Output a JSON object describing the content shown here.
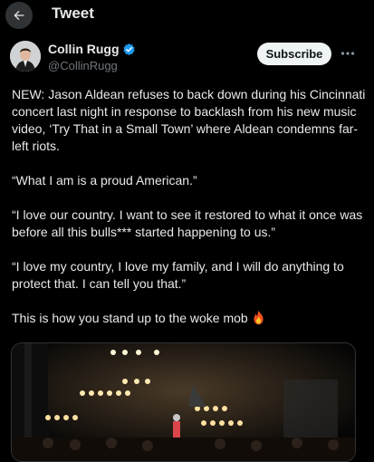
{
  "header": {
    "title": "Tweet"
  },
  "author": {
    "name": "Collin Rugg",
    "handle": "@CollinRugg"
  },
  "subscribe_label": "Subscribe",
  "tweet": {
    "paragraphs": [
      "NEW: Jason Aldean refuses to back down during his Cincinnati concert last night in response to backlash from his new music video, ‘Try That in a Small Town’ where Aldean condemns far-left riots.",
      "“What I am is a proud American.”",
      "“I love our country. I want to see it restored to what it once was before all this bulls*** started happening to us.”",
      "“I love my country, I love my family, and I will do anything to protect that. I can tell you that.”",
      "This is how you stand up to the woke mob"
    ],
    "emoji": "fire-emoji"
  },
  "icons": {
    "back": "back-arrow-icon",
    "verified": "verified-badge-icon",
    "more": "more-options-icon"
  },
  "colors": {
    "background": "#000000",
    "text": "#e7e9ea",
    "secondary": "#71767b",
    "verified": "#1d9bf0",
    "button_bg": "#eff3f4"
  }
}
